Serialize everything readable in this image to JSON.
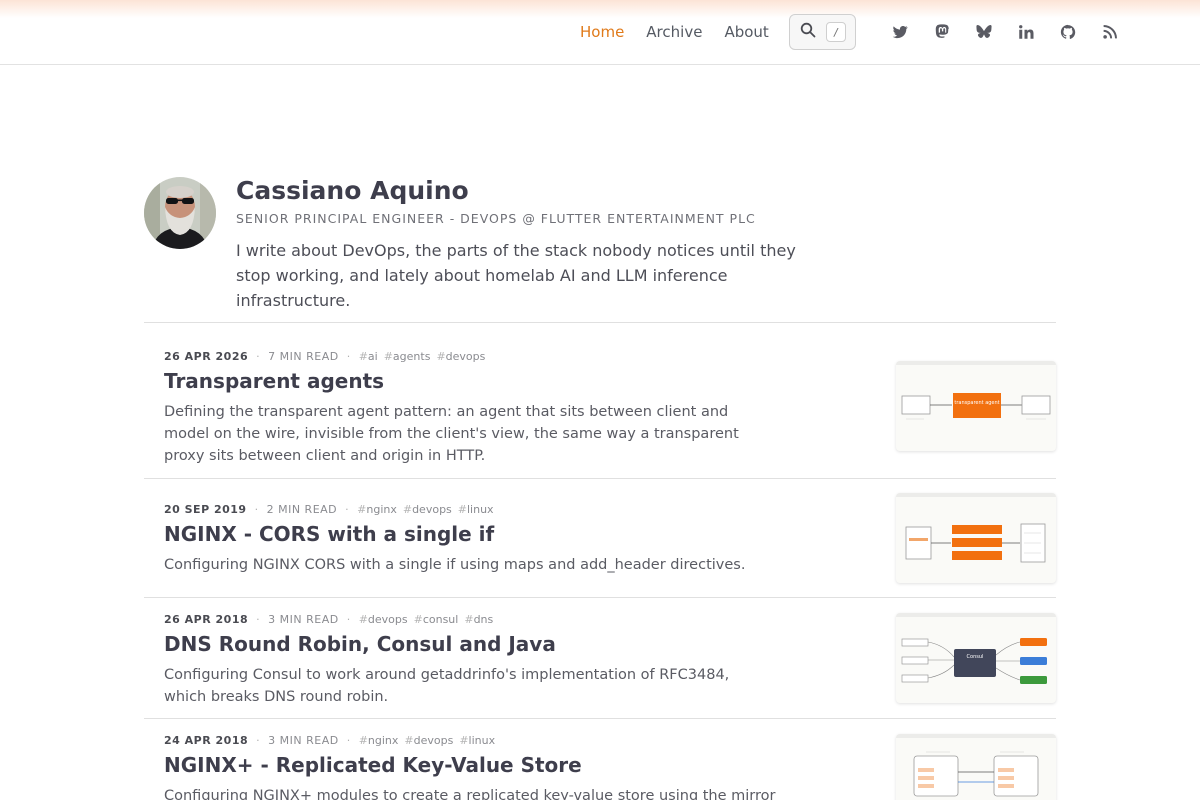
{
  "nav": {
    "items": [
      {
        "label": "Home",
        "active": true
      },
      {
        "label": "Archive",
        "active": false
      },
      {
        "label": "About",
        "active": false
      }
    ],
    "search_shortcut": "/",
    "accent_color": "#e07a1a"
  },
  "social_icons": [
    "twitter-icon",
    "mastodon-icon",
    "bluesky-icon",
    "linkedin-icon",
    "github-icon",
    "rss-icon"
  ],
  "profile": {
    "name": "Cassiano Aquino",
    "role": "SENIOR PRINCIPAL ENGINEER - DEVOPS @ FLUTTER ENTERTAINMENT PLC",
    "bio": "I write about DevOps, the parts of the stack nobody notices until they stop working, and lately about homelab AI and LLM inference infrastructure."
  },
  "posts": [
    {
      "date": "26 APR 2026",
      "read_time": "7 MIN READ",
      "tags": [
        "ai",
        "agents",
        "devops"
      ],
      "title": "Transparent agents",
      "description": "Defining the transparent agent pattern: an agent that sits between client and model on the wire, invisible from the client's view, the same way a transparent proxy sits between client and origin in HTTP.",
      "thumb_label": "transparent agent"
    },
    {
      "date": "20 SEP 2019",
      "read_time": "2 MIN READ",
      "tags": [
        "nginx",
        "devops",
        "linux"
      ],
      "title": "NGINX - CORS with a single if",
      "description": "Configuring NGINX CORS with a single if using maps and add_header directives."
    },
    {
      "date": "26 APR 2018",
      "read_time": "3 MIN READ",
      "tags": [
        "devops",
        "consul",
        "dns"
      ],
      "title": "DNS Round Robin, Consul and Java",
      "description": "Configuring Consul to work around getaddrinfo's implementation of RFC3484, which breaks DNS round robin.",
      "thumb_label": "Consul"
    },
    {
      "date": "24 APR 2018",
      "read_time": "3 MIN READ",
      "tags": [
        "nginx",
        "devops",
        "linux"
      ],
      "title": "NGINX+ - Replicated Key-Value Store",
      "description": "Configuring NGINX+ modules to create a replicated key-value store using the mirror"
    }
  ]
}
